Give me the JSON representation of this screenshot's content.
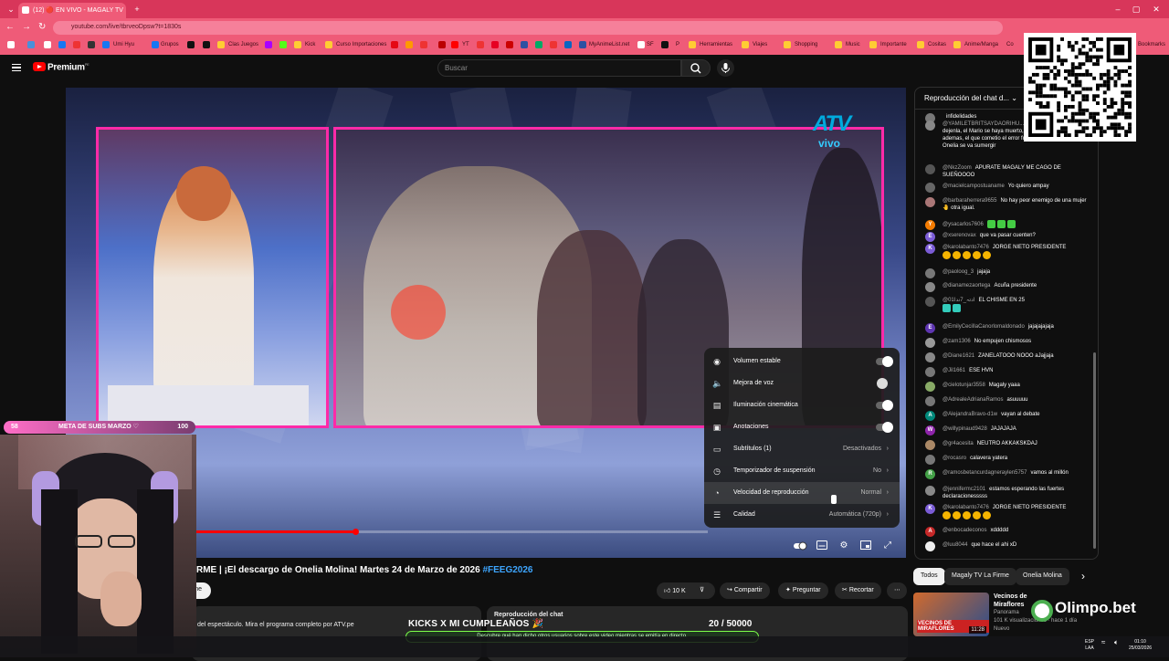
{
  "browser": {
    "tab_title": "(12) 🔴 EN VIVO - MAGALY TV",
    "url": "youtube.com/live/tbrveoDpsw?t=1830s",
    "bookmarks": [
      "Umi Hyu",
      "Grupos",
      "Clas Juegos",
      "Kick",
      "Curso Importaciones",
      "YT",
      "MyAnimeList.net",
      "SF",
      "P",
      "Herramientas",
      "Viajes",
      "Shopping",
      "Music",
      "Importante",
      "Cositas",
      "Anime/Manga",
      "Co",
      "Bookmarks"
    ]
  },
  "header": {
    "logo_text": "Premium",
    "logo_sup": "PE",
    "search_placeholder": "Buscar"
  },
  "video": {
    "overlay_brand": "ATV",
    "overlay_brand_sub": "vivo",
    "progress": 0.31,
    "title_main": "RME | ¡El descargo de Onelia Molina! Martes 24 de Marzo de 2026 ",
    "title_tag": "#FEEG2026",
    "subscribe_label": "rme",
    "likes": "10 K",
    "share": "Compartir",
    "ask": "Preguntar",
    "clip": "Recortar",
    "description": "del espectáculo. Mira el programa completo por ATV.pe",
    "chat_replay_label": "Reproducción del chat",
    "chat_replay_hint": "Descubre qué han dicho otros usuarios sobre este video mientras se emitía en directo."
  },
  "settings": {
    "rows": [
      {
        "label": "Volumen estable",
        "toggle": true
      },
      {
        "label": "Mejora de voz",
        "toggle": false
      },
      {
        "label": "Iluminación cinemática",
        "toggle": true
      },
      {
        "label": "Anotaciones",
        "toggle": true
      },
      {
        "label": "Subtítulos (1)",
        "value": "Desactivados"
      },
      {
        "label": "Temporizador de suspensión",
        "value": "No"
      },
      {
        "label": "Velocidad de reproducción",
        "value": "Normal"
      },
      {
        "label": "Calidad",
        "value": "Automática (720p)"
      }
    ]
  },
  "chat": {
    "header": "Reproducción del chat d...",
    "messages": [
      {
        "author": "",
        "text": "infidelidades",
        "color": "#777"
      },
      {
        "author": "@YAMILETBRITSAYDAORIHU...",
        "text": "los disfrute la Onelia, dejenla, el Mario se haya muerto, le fue infiel, merece, ademas, el que cometio el error fue el y no la Onelia, al Onelia se va sumergir",
        "color": "#888"
      },
      {
        "author": "@NkzZoom",
        "text": "APURATE MAGALY ME CAGO DE SUEÑOOOO",
        "color": "#555"
      },
      {
        "author": "@macielcampostuaname",
        "text": "Yo quiero ampay",
        "color": "#666"
      },
      {
        "author": "@barbaraherrera9655",
        "text": "No hay peor enemigo de una mujer 🤚 otra igual.",
        "color": "#a77"
      },
      {
        "author": "@ysacarlos7606",
        "text": "",
        "color": "#f57c00",
        "letter": "Y",
        "emoji": "green3"
      },
      {
        "author": "@xserenovax",
        "text": "que va pasar cuenten?",
        "color": "#7b5cd6",
        "letter": "E"
      },
      {
        "author": "@karolabanto7476",
        "text": "JORGE NIETO PRESIDENTE",
        "color": "#7b5cd6",
        "letter": "K",
        "emoji": "sun5"
      },
      {
        "author": "@paoloog_3",
        "text": "jajaja",
        "color": "#777"
      },
      {
        "author": "@dianamezaortega",
        "text": "Acuña presidente",
        "color": "#888"
      },
      {
        "author": "@ادتہ_7ندا01",
        "text": "EL CHISME EN 25",
        "color": "#555",
        "emoji": "teal4"
      },
      {
        "author": "@EmilyCecilIaCanorlomaldonado",
        "text": "jajajajajaja",
        "color": "#5e35b1",
        "letter": "E"
      },
      {
        "author": "@zam1306",
        "text": "No empujen chismosos",
        "color": "#999"
      },
      {
        "author": "@Diane1621",
        "text": "ZANELATOOO NOOO aJajjaja",
        "color": "#888"
      },
      {
        "author": "@Jil1661",
        "text": "ESE HVN",
        "color": "#777"
      },
      {
        "author": "@cielotunjar3558",
        "text": "Magaly yaaa",
        "color": "#8a6"
      },
      {
        "author": "@AdrealeAdrianaRamos",
        "text": "asuuuuu",
        "color": "#777"
      },
      {
        "author": "@AlejandraBravo-d1w",
        "text": "vayan al debate",
        "color": "#00897b",
        "letter": "A"
      },
      {
        "author": "@willypinaud9428",
        "text": "JAJAJAJA",
        "color": "#8e24aa",
        "letter": "W"
      },
      {
        "author": "@gr4acesita",
        "text": "NEUTRO AKKAKSKDAJ",
        "color": "#a86"
      },
      {
        "author": "@rocasro",
        "text": "calavera yatera",
        "color": "#777"
      },
      {
        "author": "@ramosbetancurdagneraylen5757",
        "text": "vamos al millón",
        "color": "#43a047",
        "letter": "R"
      },
      {
        "author": "@jennifermc2101",
        "text": "estamos esperando las fuertes declaracionesssss",
        "color": "#888"
      },
      {
        "author": "@karolabanto7476",
        "text": "JORGE NIETO PRESIDENTE",
        "color": "#7b5cd6",
        "letter": "K",
        "emoji": "sun5"
      },
      {
        "author": "@enbocadeconos",
        "text": "xddddd",
        "color": "#c62828",
        "letter": "A"
      },
      {
        "author": "@luu8044",
        "text": "que hace el ahi xD",
        "color": "#eee"
      }
    ]
  },
  "chips": [
    "Todos",
    "Magaly TV La Firme",
    "Onelia Molina"
  ],
  "recommendation": {
    "title": "Vecinos de Miraflores versus \"spa vips\": pr...",
    "channel": "Panorama",
    "meta": "101 K visualizaciones · hace 1 día",
    "badge": "Nuevo",
    "duration": "11:28"
  },
  "stream": {
    "meta_left": "58",
    "meta_label": "META DE SUBS MARZO ♡",
    "meta_right": "100",
    "kicks_label": "KICKS X MI CUMPLEAÑOS 🎉",
    "kicks_count": "20 / 50000",
    "sponsor": "Olimpo.bet"
  },
  "tray": {
    "lang": "ESP",
    "lang2": "LAA",
    "time": "01:10",
    "date": "25/03/2026"
  }
}
